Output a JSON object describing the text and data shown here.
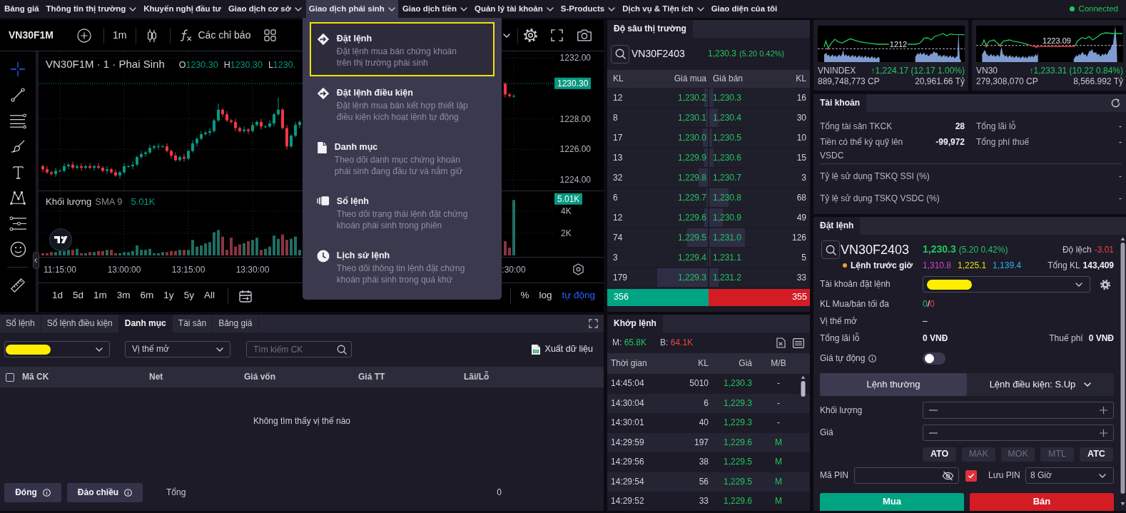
{
  "nav": {
    "items": [
      {
        "label": "Bảng giá",
        "has_menu": false,
        "expanded": false
      },
      {
        "label": "Thông tin thị trường",
        "has_menu": true,
        "expanded": false
      },
      {
        "label": "Khuyến nghị đầu tư",
        "has_menu": false,
        "expanded": false
      },
      {
        "label": "Giao dịch cơ sở",
        "has_menu": true,
        "expanded": false
      },
      {
        "label": "Giao dịch phái sinh",
        "has_menu": true,
        "expanded": true,
        "menu": [
          {
            "kind": "order",
            "title": "Đặt lệnh",
            "description": [
              "Đặt lệnh mua bán chứng khoán",
              "trên thị trường phái sinh"
            ],
            "selected": true
          },
          {
            "kind": "conditional",
            "title": "Đặt lệnh điều kiện",
            "description": [
              "Đặt lệnh mua bán kết hợp thiết lập",
              "điều kiện kích hoạt lệnh tự động"
            ],
            "selected": false
          },
          {
            "kind": "portfolio",
            "title": "Danh mục",
            "description": [
              "Theo dõi danh mục chứng khoán",
              "phái sinh đang đầu tư và nắm giữ"
            ],
            "selected": false
          },
          {
            "kind": "orderbook",
            "title": "Sổ lệnh",
            "description": [
              "Theo dõi trạng thái lệnh đặt chứng",
              "khoán phái sinh trong phiên"
            ],
            "selected": false
          },
          {
            "kind": "history",
            "title": "Lịch sử lệnh",
            "description": [
              "Theo dõi thông tin lệnh đặt chứng",
              "khoán phái sinh trong quá khứ"
            ],
            "selected": false
          }
        ]
      },
      {
        "label": "Giao dịch tiền",
        "has_menu": true,
        "expanded": false
      },
      {
        "label": "Quản lý tài khoản",
        "has_menu": true,
        "expanded": false
      },
      {
        "label": "S-Products",
        "has_menu": true,
        "expanded": false
      },
      {
        "label": "Dịch vụ & Tiện ích",
        "has_menu": true,
        "expanded": false
      },
      {
        "label": "Giao diện của tôi",
        "has_menu": false,
        "expanded": false
      }
    ],
    "status": {
      "label": "Connected",
      "connected": true
    }
  },
  "chart": {
    "symbol": "VN30F1M",
    "interval": "1m",
    "indicators": "Các chỉ báo",
    "tools": [
      {
        "kind": "crosshair",
        "selected": true
      },
      {
        "kind": "trend-line",
        "selected": false
      },
      {
        "kind": "fib",
        "selected": false
      },
      {
        "kind": "brush",
        "selected": false
      },
      {
        "kind": "text",
        "selected": false
      },
      {
        "kind": "pattern",
        "selected": false
      },
      {
        "kind": "forecast",
        "selected": false
      },
      {
        "kind": "emoji",
        "selected": false
      },
      {
        "kind": "ruler",
        "selected": false
      }
    ],
    "legend": {
      "title": "VN30F1M · 1 · Phai Sinh",
      "values": [
        {
          "key": "O",
          "value": "1230.30"
        },
        {
          "key": "H",
          "value": "1230.30"
        },
        {
          "key": "L",
          "value": "1230."
        }
      ]
    },
    "last_price": "1230.30",
    "price_pane": {
      "chart_data": {
        "type": "candlestick",
        "categories": [
          null,
          null,
          null,
          null,
          null,
          null,
          null,
          null,
          null,
          null,
          null,
          null,
          null,
          null,
          null,
          null,
          null,
          null,
          null,
          null,
          null,
          null,
          null,
          null,
          null,
          null,
          null,
          null,
          null,
          null,
          null,
          null,
          null,
          null,
          null,
          null,
          null,
          null,
          null,
          null,
          null,
          null,
          null,
          null,
          null,
          null,
          null,
          null,
          null,
          null,
          null,
          null,
          null,
          null,
          null,
          null,
          null,
          null,
          null,
          null,
          null,
          null,
          null,
          null,
          null,
          null,
          null,
          null,
          null,
          null,
          null,
          null,
          null,
          null,
          null,
          null,
          null,
          null,
          null,
          null,
          null,
          null,
          null,
          null,
          null,
          null,
          null,
          null,
          null,
          null,
          null,
          null,
          null,
          null,
          null,
          null,
          null,
          null,
          null,
          null,
          null,
          null,
          null,
          null,
          null,
          null,
          null,
          null,
          null,
          null,
          null
        ],
        "ohlc": [
          [
            1224.9,
            1225.0,
            1224.5,
            1224.7
          ],
          [
            1224.7,
            1224.9,
            1224.4,
            1224.5
          ],
          [
            1224.5,
            1224.6,
            1224.3,
            1224.4
          ],
          [
            1224.4,
            1224.8,
            1224.2,
            1224.6
          ],
          [
            1224.6,
            1224.7,
            1224.5,
            1224.6
          ],
          [
            1224.6,
            1225.1,
            1224.5,
            1224.9
          ],
          [
            1224.9,
            1225.1,
            1224.7,
            1225.0
          ],
          [
            1225.0,
            1225.2,
            1224.7,
            1224.8
          ],
          [
            1224.8,
            1225.0,
            1224.7,
            1224.9
          ],
          [
            1224.9,
            1225.1,
            1224.6,
            1224.8
          ],
          [
            1224.8,
            1225.0,
            1224.7,
            1224.9
          ],
          [
            1224.9,
            1225.1,
            1224.7,
            1224.8
          ],
          [
            1224.8,
            1225.0,
            1224.6,
            1224.9
          ],
          [
            1224.9,
            1225.1,
            1224.7,
            1224.8
          ],
          [
            1224.8,
            1224.9,
            1224.5,
            1224.6
          ],
          [
            1224.6,
            1224.9,
            1224.4,
            1224.7
          ],
          [
            1224.7,
            1224.8,
            1224.4,
            1224.5
          ],
          [
            1224.5,
            1224.7,
            1224.2,
            1224.3
          ],
          [
            1224.3,
            1224.6,
            1224.1,
            1224.5
          ],
          [
            1224.5,
            1225.1,
            1224.4,
            1224.9
          ],
          [
            1224.9,
            1225.0,
            1224.8,
            1224.9
          ],
          [
            1224.9,
            1225.2,
            1224.7,
            1225.0
          ],
          [
            1225.0,
            1225.6,
            1224.9,
            1225.5
          ],
          [
            1225.5,
            1225.9,
            1225.4,
            1225.7
          ],
          [
            1225.7,
            1225.9,
            1225.5,
            1225.8
          ],
          [
            1225.8,
            1226.3,
            1225.7,
            1226.1
          ],
          [
            1226.1,
            1226.3,
            1226.0,
            1226.2
          ],
          [
            1226.2,
            1226.4,
            1226.0,
            1226.2
          ],
          [
            1226.2,
            1226.3,
            1226.1,
            1226.2
          ],
          [
            1226.2,
            1226.4,
            1225.8,
            1225.9
          ],
          [
            1225.9,
            1226.0,
            1225.4,
            1225.6
          ],
          [
            1225.6,
            1225.8,
            1225.2,
            1225.3
          ],
          [
            1225.3,
            1225.6,
            1225.2,
            1225.5
          ],
          [
            1225.5,
            1225.7,
            1225.2,
            1225.4
          ],
          [
            1225.4,
            1226.0,
            1225.3,
            1225.9
          ],
          [
            1225.9,
            1226.6,
            1225.8,
            1226.4
          ],
          [
            1226.4,
            1226.8,
            1226.2,
            1226.7
          ],
          [
            1226.7,
            1227.2,
            1226.6,
            1227.0
          ],
          [
            1227.0,
            1227.2,
            1226.9,
            1227.1
          ],
          [
            1227.1,
            1227.4,
            1226.9,
            1227.2
          ],
          [
            1227.2,
            1228.0,
            1227.1,
            1227.9
          ],
          [
            1227.9,
            1229.0,
            1227.8,
            1228.6
          ],
          [
            1228.6,
            1228.7,
            1228.1,
            1228.3
          ],
          [
            1228.3,
            1228.5,
            1227.8,
            1227.9
          ],
          [
            1227.9,
            1228.0,
            1227.7,
            1227.8
          ],
          [
            1227.8,
            1228.0,
            1227.2,
            1227.4
          ],
          [
            1227.4,
            1227.5,
            1227.1,
            1227.2
          ],
          [
            1227.2,
            1227.5,
            1227.1,
            1227.3
          ],
          [
            1227.3,
            1227.4,
            1227.0,
            1227.2
          ],
          [
            1227.2,
            1227.8,
            1227.1,
            1227.6
          ],
          [
            1227.6,
            1227.9,
            1227.5,
            1227.8
          ],
          [
            1227.8,
            1228.0,
            1227.3,
            1227.5
          ],
          [
            1227.5,
            1227.6,
            1227.4,
            1227.5
          ],
          [
            1227.5,
            1227.9,
            1227.4,
            1227.7
          ],
          [
            1227.7,
            1228.4,
            1227.5,
            1228.3
          ],
          [
            1228.3,
            1229.4,
            1228.2,
            1228.6
          ],
          [
            1228.6,
            1228.7,
            1227.3,
            1227.4
          ],
          [
            1227.4,
            1227.6,
            1226.0,
            1226.2
          ],
          [
            1226.2,
            1227.0,
            1226.1,
            1226.9
          ],
          [
            1226.9,
            1227.8,
            1226.8,
            1227.6
          ],
          [
            1227.6,
            1227.9,
            1227.4,
            1227.8
          ],
          null,
          null,
          null,
          null,
          null,
          null,
          null,
          null,
          null,
          null,
          null,
          null,
          null,
          null,
          null,
          null,
          null,
          null,
          null,
          null,
          null,
          null,
          null,
          null,
          null,
          null,
          null,
          null,
          null,
          null,
          null,
          null,
          null,
          null,
          null,
          null,
          null,
          null,
          null,
          null,
          null,
          null,
          null,
          null,
          null,
          null,
          null,
          [
            1230.3,
            1230.4,
            1229.4,
            1229.6
          ],
          [
            1229.6,
            1229.7,
            1229.4,
            1229.5
          ],
          [
            1229.5,
            1229.6,
            1229.4,
            1229.5
          ]
        ],
        "ylim": [
          1223.31,
          1232.42
        ],
        "yticks": [
          {
            "value": 1232,
            "label": "1232.00"
          },
          {
            "value": 1228,
            "label": "1228.00"
          },
          {
            "value": 1226,
            "label": "1226.00"
          },
          {
            "value": 1224,
            "label": "1224.00"
          }
        ],
        "grid": true
      }
    },
    "volume_legend": {
      "title": "Khối lượng",
      "indicator": "SMA 9",
      "value": "5.01K"
    },
    "last_volume": "5.01K",
    "volume_pane": {
      "chart_data": {
        "type": "bar",
        "categories": [
          null,
          null,
          null,
          null,
          "11:15:00",
          null,
          null,
          null,
          null,
          null,
          null,
          null,
          null,
          null,
          null,
          null,
          null,
          null,
          null,
          "13:00:00",
          null,
          null,
          null,
          null,
          null,
          null,
          null,
          null,
          null,
          null,
          null,
          null,
          null,
          null,
          "13:15:00",
          null,
          null,
          null,
          null,
          null,
          null,
          null,
          null,
          null,
          null,
          null,
          null,
          null,
          null,
          "13:30:00",
          null,
          null,
          null,
          null,
          null,
          null,
          null,
          null,
          null,
          null,
          null,
          null,
          null,
          null,
          null,
          null,
          null,
          null,
          null,
          null,
          null,
          null,
          null,
          null,
          null,
          null,
          null,
          null,
          null,
          null,
          null,
          null,
          null,
          null,
          null,
          null,
          null,
          null,
          null,
          null,
          null,
          null,
          null,
          null,
          null,
          null,
          null,
          null,
          null,
          null,
          null,
          null,
          null,
          null,
          null,
          null,
          null,
          null,
          null,
          null,
          ":30:00"
        ],
        "values": [
          200,
          200,
          300,
          300,
          400,
          400,
          500,
          500,
          600,
          200,
          200,
          300,
          300,
          400,
          400,
          500,
          500,
          200,
          200,
          300,
          300,
          400,
          900,
          500,
          500,
          600,
          200,
          200,
          300,
          300,
          400,
          400,
          500,
          500,
          500,
          1400,
          800,
          900,
          1100,
          1200,
          2100,
          2300,
          1700,
          500,
          1600,
          800,
          1000,
          1100,
          1300,
          1400,
          1600,
          500,
          600,
          800,
          1800,
          1500,
          1900,
          1400,
          1500,
          1700,
          500,
          null,
          null,
          null,
          null,
          null,
          null,
          null,
          null,
          null,
          null,
          null,
          null,
          null,
          null,
          null,
          null,
          null,
          null,
          null,
          null,
          null,
          null,
          null,
          null,
          null,
          null,
          null,
          null,
          null,
          null,
          null,
          null,
          null,
          null,
          null,
          null,
          null,
          null,
          null,
          null,
          null,
          null,
          null,
          null,
          null,
          null,
          null,
          1300,
          700,
          5010
        ],
        "ylim": [
          0,
          5870
        ],
        "yticks": [
          {
            "value": 4000,
            "label": "4K"
          },
          {
            "value": 2000,
            "label": "2K"
          }
        ],
        "grid": true
      }
    },
    "ranges": [
      "1d",
      "5d",
      "1m",
      "3m",
      "6m",
      "1y",
      "5y",
      "All"
    ],
    "scale_options": [
      {
        "label": "%",
        "selected": false
      },
      {
        "label": "log",
        "selected": false
      },
      {
        "label": "tự động",
        "selected": true
      }
    ]
  },
  "portfolio": {
    "tabs": [
      {
        "label": "Sổ lệnh",
        "selected": false
      },
      {
        "label": "Sổ lệnh điều kiện",
        "selected": false
      },
      {
        "label": "Danh mục",
        "selected": true
      },
      {
        "label": "Tài sản",
        "selected": false
      },
      {
        "label": "Bảng giá",
        "selected": false
      }
    ],
    "account_redacted": true,
    "filter": "Vị thế mở",
    "search_placeholder": "Tìm kiếm CK",
    "export": "Xuất dữ liệu",
    "select_all": false,
    "columns": [
      "Mã CK",
      "Net",
      "Giá vốn",
      "Giá TT",
      "Lãi/Lỗ"
    ],
    "empty_message": "Không tìm thấy vị thế nào",
    "actions": [
      "Đóng",
      "Đảo chiều"
    ],
    "total_label": "Tổng",
    "total": "0"
  },
  "depth": {
    "tab": "Độ sâu thị trường",
    "symbol": "VN30F2403",
    "price": "1,230.3",
    "change": "(5.20 0.42%)",
    "columns": [
      "KL",
      "Giá mua",
      "Giá bán",
      "KL"
    ],
    "rows": [
      {
        "bid": {
          "volume": "12",
          "price": "1,230.2",
          "level": 0.034
        },
        "ask": {
          "price": "1,230.3",
          "volume": "16",
          "level": 0.045
        }
      },
      {
        "bid": {
          "volume": "8",
          "price": "1,230.1",
          "level": 0.022
        },
        "ask": {
          "price": "1,230.4",
          "volume": "30",
          "level": 0.085
        }
      },
      {
        "bid": {
          "volume": "17",
          "price": "1,230.0",
          "level": 0.048
        },
        "ask": {
          "price": "1,230.5",
          "volume": "10",
          "level": 0.028
        }
      },
      {
        "bid": {
          "volume": "13",
          "price": "1,229.9",
          "level": 0.037
        },
        "ask": {
          "price": "1,230.6",
          "volume": "15",
          "level": 0.042
        }
      },
      {
        "bid": {
          "volume": "32",
          "price": "1,229.8",
          "level": 0.09
        },
        "ask": {
          "price": "1,230.7",
          "volume": "3",
          "level": 0.008
        }
      },
      {
        "bid": {
          "volume": "6",
          "price": "1,229.7",
          "level": 0.017
        },
        "ask": {
          "price": "1,230.8",
          "volume": "68",
          "level": 0.192
        }
      },
      {
        "bid": {
          "volume": "12",
          "price": "1,229.6",
          "level": 0.034
        },
        "ask": {
          "price": "1,230.9",
          "volume": "49",
          "level": 0.138
        }
      },
      {
        "bid": {
          "volume": "74",
          "price": "1,229.5",
          "level": 0.208
        },
        "ask": {
          "price": "1,231.0",
          "volume": "126",
          "level": 0.355
        }
      },
      {
        "bid": {
          "volume": "3",
          "price": "1,229.4",
          "level": 0.008
        },
        "ask": {
          "price": "1,231.1",
          "volume": "5",
          "level": 0.014
        }
      },
      {
        "bid": {
          "volume": "179",
          "price": "1,229.3",
          "level": 0.503
        },
        "ask": {
          "price": "1,231.2",
          "volume": "33",
          "level": 0.093
        }
      }
    ],
    "totals": {
      "bid": "356",
      "ask": "355",
      "level": 0.5
    }
  },
  "trades": {
    "tab": "Khớp lệnh",
    "buy": {
      "label": "M:",
      "value": "65.8K"
    },
    "sell": {
      "label": "B:",
      "value": "64.1K"
    },
    "columns": [
      "Thời gian",
      "KL",
      "Giá",
      "M/B"
    ],
    "rows": [
      {
        "time": "14:45:04",
        "volume": "5010",
        "price": "1,230.3",
        "side": "-",
        "kind": "none"
      },
      {
        "time": "14:30:04",
        "volume": "6",
        "price": "1,229.3",
        "side": "-",
        "kind": "none"
      },
      {
        "time": "14:30:01",
        "volume": "40",
        "price": "1,229.3",
        "side": "-",
        "kind": "none"
      },
      {
        "time": "14:29:59",
        "volume": "197",
        "price": "1,229.6",
        "side": "M",
        "kind": "buy"
      },
      {
        "time": "14:29:56",
        "volume": "38",
        "price": "1,229.5",
        "side": "M",
        "kind": "buy"
      },
      {
        "time": "14:29:54",
        "volume": "56",
        "price": "1,229.5",
        "side": "M",
        "kind": "buy"
      },
      {
        "time": "14:29:52",
        "volume": "33",
        "price": "1,229.6",
        "side": "M",
        "kind": "buy"
      }
    ]
  },
  "indices": [
    {
      "name": "VNINDEX",
      "chart_label": "1212",
      "change": "↑1,224.17 (12.17 1.00%)",
      "volume": "889,748,773 CP",
      "value": "20,961.66 Tỷ"
    },
    {
      "name": "VN30",
      "chart_label": "1223.09",
      "change": "↑1,233.31 (10.22 0.84%)",
      "volume": "279,308,070 CP",
      "value": "8,566.992 Tỷ"
    }
  ],
  "account": {
    "title": "Tài khoản",
    "summary": [
      {
        "label": "Tổng tài sản TKCK",
        "value": "28"
      },
      {
        "label": "Tổng lãi lỗ",
        "value": "-"
      },
      {
        "label": "Tiền có thể ký quỹ lên VSDC",
        "value": "-99,972"
      },
      {
        "label": "Tổng phí thuế",
        "value": "-"
      }
    ],
    "ratios": [
      {
        "label": "Tỷ lệ sử dụng TSKQ SSI (%)",
        "value": "-"
      },
      {
        "label": "Tỷ lệ sử dụng TSKQ VSDC (%)",
        "value": "-"
      }
    ]
  },
  "order": {
    "title": "Đặt lệnh",
    "symbol": "VN30F2403",
    "price": "1,230.3",
    "change": "(5.20 0.42%)",
    "session": "Lệnh trước giờ",
    "ceiling": "1,310.8",
    "reference": "1,225.1",
    "floor": "1,139.4",
    "deviation_label": "Độ lệch",
    "deviation": "-3.01",
    "total_volume_label": "Tổng KL",
    "total_volume": "143,409",
    "account_label": "Tài khoản đặt lệnh",
    "account_redacted": true,
    "max_label": "KL Mua/bán tối đa",
    "max_buy": "0",
    "max_separator": "/",
    "max_sell": "0",
    "position_label": "Vị thế mở",
    "position": "–",
    "pnl_label": "Tổng lãi lỗ",
    "pnl": "0 VNĐ",
    "fee_label": "Thuế phí",
    "fee": "0 VNĐ",
    "auto_price_label": "Giá tự động",
    "auto_price": false,
    "tabs": [
      {
        "label": "Lệnh thường",
        "selected": true,
        "has_menu": false
      },
      {
        "label": "Lệnh điều kiện: S.Up",
        "selected": false,
        "has_menu": true
      }
    ],
    "quantity_label": "Khối lượng",
    "price_label": "Giá",
    "price_types": [
      {
        "label": "ATO",
        "disabled": false
      },
      {
        "label": "MAK",
        "disabled": true
      },
      {
        "label": "MOK",
        "disabled": true
      },
      {
        "label": "MTL",
        "disabled": true
      },
      {
        "label": "ATC",
        "disabled": false
      }
    ],
    "pin_label": "Mã PIN",
    "save_pin": true,
    "save_pin_label": "Lưu PIN",
    "save_duration": "8 Giờ",
    "buy_label": "Mua",
    "sell_label": "Bán"
  }
}
